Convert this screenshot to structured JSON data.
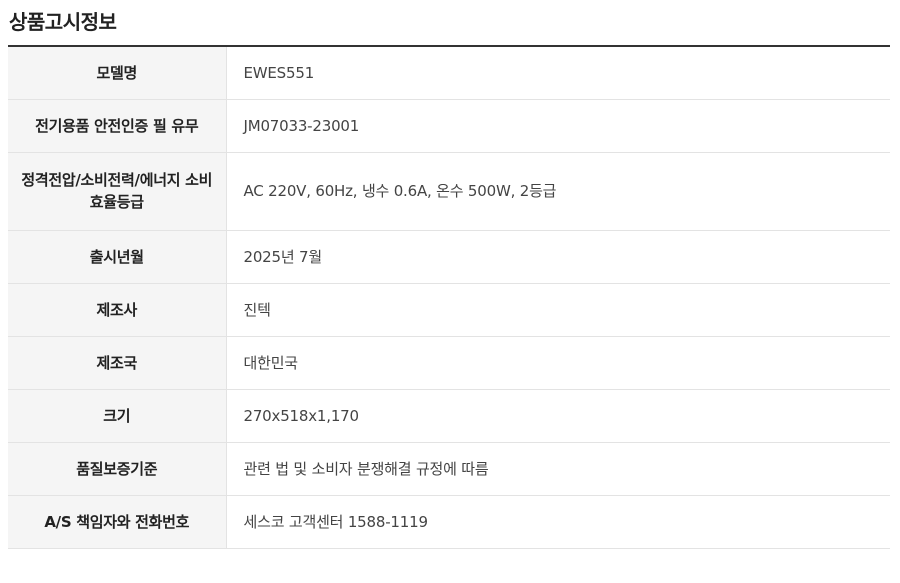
{
  "section": {
    "title": "상품고시정보"
  },
  "rows": [
    {
      "label": "모델명",
      "value": "EWES551"
    },
    {
      "label": "전기용품 안전인증 필 유무",
      "value": "JM07033-23001"
    },
    {
      "label": "정격전압/소비전력/에너지 소비효율등급",
      "value": "AC 220V, 60Hz, 냉수 0.6A, 온수 500W, 2등급"
    },
    {
      "label": "출시년월",
      "value": "2025년 7월"
    },
    {
      "label": "제조사",
      "value": "진텍"
    },
    {
      "label": "제조국",
      "value": "대한민국"
    },
    {
      "label": "크기",
      "value": "270x518x1,170"
    },
    {
      "label": "품질보증기준",
      "value": "관련 법 및 소비자 분쟁해결 규정에 따름"
    },
    {
      "label": "A/S 책임자와 전화번호",
      "value": "세스코 고객센터 1588-1119"
    }
  ]
}
